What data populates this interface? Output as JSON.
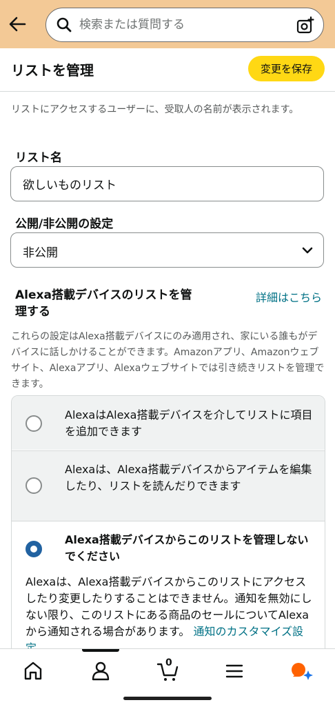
{
  "search": {
    "placeholder": "検索または質問する"
  },
  "header": {
    "title": "リストを管理",
    "save_label": "変更を保存"
  },
  "note": "リストにアクセスするユーザーに、受取人の名前が表示されます。",
  "list_name": {
    "label": "リスト名",
    "value": "欲しいものリスト"
  },
  "privacy": {
    "label": "公開/非公開の設定",
    "selected": "非公開"
  },
  "alexa": {
    "heading": "Alexa搭載デバイスのリストを管理する",
    "details_link": "詳細はこちら",
    "description": "これらの設定はAlexa搭載デバイスにのみ適用され、家にいる誰もがデバイスに話しかけることができます。Amazonアプリ、Amazonウェブサイト、Alexaアプリ、Alexaウェブサイトでは引き続きリストを管理できます。",
    "options": [
      {
        "label": "AlexaはAlexa搭載デバイスを介してリストに項目を追加できます",
        "selected": false
      },
      {
        "label": "Alexaは、Alexa搭載デバイスからアイテムを編集したり、リストを読んだりできます",
        "selected": false
      },
      {
        "label": "Alexa搭載デバイスからこのリストを管理しないでください",
        "selected": true
      }
    ],
    "selected_detail": "Alexaは、Alexa搭載デバイスからこのリストにアクセスしたり変更したりすることはできません。通知を無効にしない限り、このリストにある商品のセールについてAlexaから通知される場合があります。",
    "customize_link": "通知のカスタマイズ設定"
  },
  "nav": {
    "cart_count": "0"
  },
  "colors": {
    "header_bg": "#f3c996",
    "save_button": "#ffd814",
    "link": "#007185",
    "radio_selected": "#2162a1",
    "accent_orange": "#ff6200",
    "accent_blue": "#1a73e8"
  }
}
